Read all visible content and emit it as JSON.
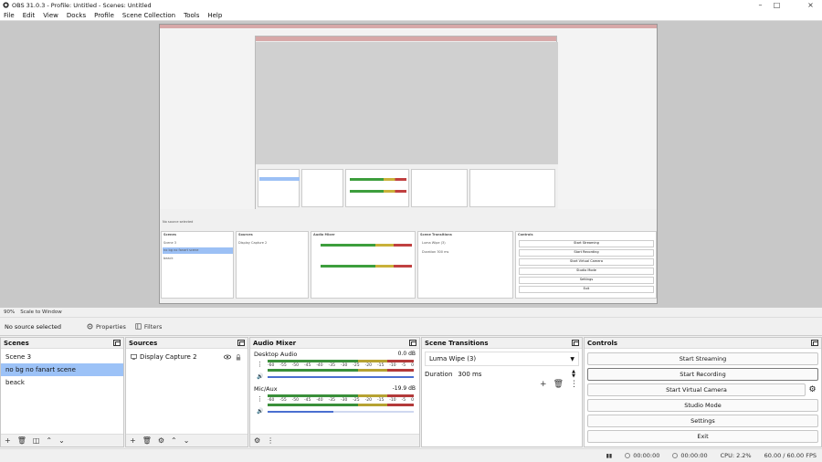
{
  "window": {
    "title": "OBS 31.0.3 - Profile: Untitled - Scenes: Untitled"
  },
  "menu": [
    "File",
    "Edit",
    "View",
    "Docks",
    "Profile",
    "Scene Collection",
    "Tools",
    "Help"
  ],
  "preview": {
    "zoom": "90%",
    "scale_mode": "Scale to Window"
  },
  "context_bar": {
    "source_status": "No source selected",
    "properties_label": "Properties",
    "filters_label": "Filters"
  },
  "docks": {
    "scenes": {
      "title": "Scenes",
      "items": [
        "Scene 3",
        "no bg no fanart scene",
        "beack"
      ],
      "selected_index": 1
    },
    "sources": {
      "title": "Sources",
      "items": [
        {
          "label": "Display Capture 2"
        }
      ]
    },
    "audio_mixer": {
      "title": "Audio Mixer",
      "channels": [
        {
          "name": "Desktop Audio",
          "db": "0.0 dB",
          "volume": 1.0
        },
        {
          "name": "Mic/Aux",
          "db": "-19.9 dB",
          "volume": 0.45
        }
      ],
      "ticks": [
        "-60",
        "-55",
        "-50",
        "-45",
        "-40",
        "-35",
        "-30",
        "-25",
        "-20",
        "-15",
        "-10",
        "-5",
        "0"
      ]
    },
    "scene_transitions": {
      "title": "Scene Transitions",
      "transition": "Luma Wipe (3)",
      "duration_label": "Duration",
      "duration_value": "300 ms"
    },
    "controls": {
      "title": "Controls",
      "buttons": [
        "Start Streaming",
        "Start Recording",
        "Start Virtual Camera",
        "Studio Mode",
        "Settings",
        "Exit"
      ]
    }
  },
  "status_bar": {
    "stream_time": "00:00:00",
    "record_time": "00:00:00",
    "cpu": "CPU: 2.2%",
    "fps": "60.00 / 60.00 FPS"
  },
  "colors": {
    "selection": "#9cc2f7",
    "titlebar_nested": "#d7a8a8",
    "accent": "#4a6fd0"
  }
}
